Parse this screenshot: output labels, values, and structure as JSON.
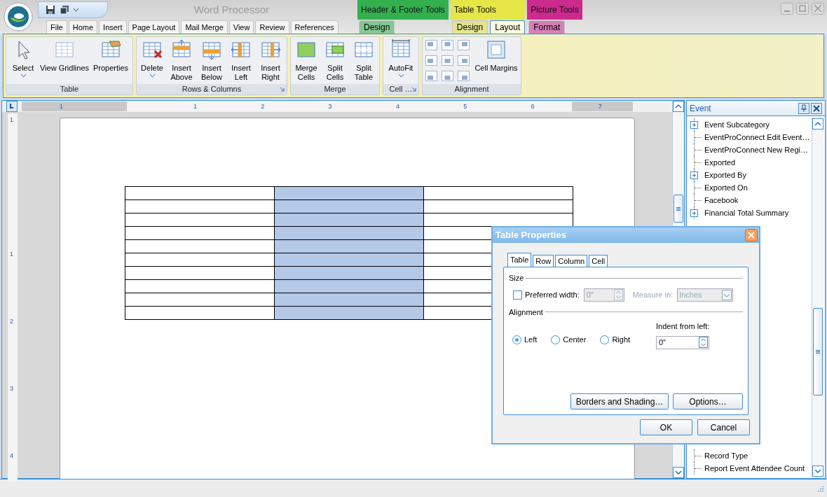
{
  "window": {
    "title": "Word Processor"
  },
  "tabs": [
    {
      "label": "File",
      "selected": false
    },
    {
      "label": "Home",
      "selected": false
    },
    {
      "label": "Insert",
      "selected": false
    },
    {
      "label": "Page Layout",
      "selected": false
    },
    {
      "label": "Mail Merge",
      "selected": false
    },
    {
      "label": "View",
      "selected": false
    },
    {
      "label": "Review",
      "selected": false
    },
    {
      "label": "References",
      "selected": false
    }
  ],
  "context_groups": [
    {
      "title": "Header & Footer Tools",
      "color": "#33b04e",
      "tabs": [
        {
          "label": "Design",
          "selected": false
        }
      ]
    },
    {
      "title": "Table Tools",
      "color": "#e6e646",
      "tabs": [
        {
          "label": "Design",
          "selected": false
        },
        {
          "label": "Layout",
          "selected": true
        }
      ]
    },
    {
      "title": "Picture Tools",
      "color": "#cc2a8e",
      "tabs": [
        {
          "label": "Format",
          "selected": false
        }
      ]
    }
  ],
  "ribbon": {
    "groups": [
      {
        "label": "Table",
        "kind": "buttons",
        "launcher": false,
        "buttons": [
          {
            "kind": "select",
            "label": "Select",
            "dropdown": true
          },
          {
            "kind": "gridlines",
            "label": "View Gridlines",
            "dropdown": false
          },
          {
            "kind": "properties",
            "label": "Properties",
            "dropdown": false
          }
        ]
      },
      {
        "label": "Rows & Columns",
        "kind": "buttons",
        "launcher": true,
        "buttons": [
          {
            "kind": "delete",
            "label": "Delete",
            "dropdown": true
          },
          {
            "kind": "insert-above",
            "label": "Insert Above",
            "dropdown": false
          },
          {
            "kind": "insert-below",
            "label": "Insert Below",
            "dropdown": false
          },
          {
            "kind": "insert-left",
            "label": "Insert Left",
            "dropdown": false
          },
          {
            "kind": "insert-right",
            "label": "Insert Right",
            "dropdown": false
          }
        ]
      },
      {
        "label": "Merge",
        "kind": "buttons",
        "launcher": false,
        "buttons": [
          {
            "kind": "merge",
            "label": "Merge Cells",
            "dropdown": false
          },
          {
            "kind": "split-cells",
            "label": "Split Cells",
            "dropdown": false
          },
          {
            "kind": "split-table",
            "label": "Split Table",
            "dropdown": false
          }
        ]
      },
      {
        "label": "Cell …",
        "kind": "buttons",
        "launcher": true,
        "buttons": [
          {
            "kind": "autofit",
            "label": "AutoFit",
            "dropdown": true
          }
        ]
      },
      {
        "label": "Alignment",
        "kind": "alignment",
        "launcher": false,
        "buttons": [
          {
            "kind": "margins",
            "label": "Cell Margins",
            "dropdown": false
          }
        ]
      }
    ]
  },
  "ruler": {
    "labels": [
      "1",
      "1",
      "2",
      "3",
      "4",
      "5",
      "6",
      "7"
    ]
  },
  "vertical_ruler": {
    "labels": [
      "1",
      "1",
      "2",
      "3",
      "4"
    ]
  },
  "document_table": {
    "rows": [
      [
        {
          "selected": false
        },
        {
          "selected": true
        },
        {
          "selected": false
        }
      ],
      [
        {
          "selected": false
        },
        {
          "selected": true
        },
        {
          "selected": false
        }
      ],
      [
        {
          "selected": false
        },
        {
          "selected": true
        },
        {
          "selected": false
        }
      ],
      [
        {
          "selected": false
        },
        {
          "selected": true
        },
        {
          "selected": false
        }
      ],
      [
        {
          "selected": false
        },
        {
          "selected": true
        },
        {
          "selected": false
        }
      ],
      [
        {
          "selected": false
        },
        {
          "selected": true
        },
        {
          "selected": false
        }
      ],
      [
        {
          "selected": false
        },
        {
          "selected": true
        },
        {
          "selected": false
        }
      ],
      [
        {
          "selected": false
        },
        {
          "selected": true
        },
        {
          "selected": false
        }
      ],
      [
        {
          "selected": false
        },
        {
          "selected": true
        },
        {
          "selected": false
        }
      ],
      [
        {
          "selected": false
        },
        {
          "selected": true
        },
        {
          "selected": false
        }
      ]
    ]
  },
  "panel": {
    "title": "Event",
    "top_items": [
      {
        "label": "Event Subcategory",
        "expandable": true
      },
      {
        "label": "EventProConnect Edit Event…",
        "expandable": false
      },
      {
        "label": "EventProConnect New Regi…",
        "expandable": false
      },
      {
        "label": "Exported",
        "expandable": false
      },
      {
        "label": "Exported By",
        "expandable": true
      },
      {
        "label": "Exported On",
        "expandable": false
      },
      {
        "label": "Facebook",
        "expandable": false
      },
      {
        "label": "Financial Total Summary",
        "expandable": true
      }
    ],
    "bottom_items": [
      {
        "label": "Record Type",
        "expandable": false
      },
      {
        "label": "Report Event Attendee Count",
        "expandable": false
      }
    ]
  },
  "dialog": {
    "title": "Table Properties",
    "tabs": [
      {
        "label": "Table",
        "selected": true
      },
      {
        "label": "Row",
        "selected": false
      },
      {
        "label": "Column",
        "selected": false
      },
      {
        "label": "Cell",
        "selected": false
      }
    ],
    "size_section": {
      "heading": "Size",
      "preferred_width": {
        "label": "Preferred width:",
        "checked": false,
        "value": "0\"",
        "disabled": true
      },
      "measure": {
        "label": "Measure in:",
        "value": "Inches",
        "disabled": true
      }
    },
    "alignment_section": {
      "heading": "Alignment",
      "options": [
        {
          "label": "Left",
          "selected": true
        },
        {
          "label": "Center",
          "selected": false
        },
        {
          "label": "Right",
          "selected": false
        }
      ],
      "indent": {
        "label": "Indent from left:",
        "value": "0\""
      }
    },
    "inner_buttons": [
      "Borders and Shading…",
      "Options…"
    ],
    "footer_buttons": [
      "OK",
      "Cancel"
    ]
  }
}
